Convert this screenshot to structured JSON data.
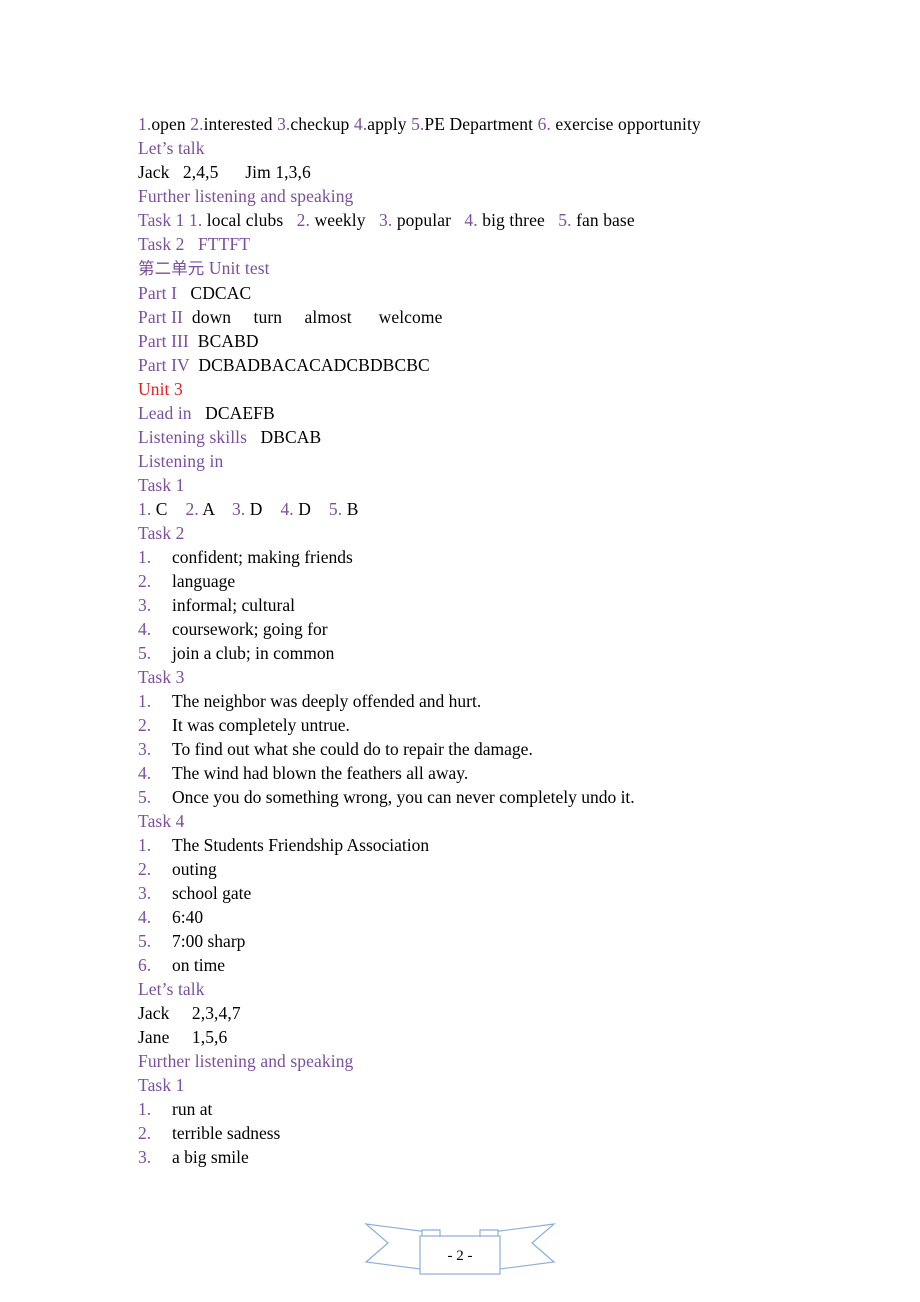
{
  "document": {
    "page_number_label": "- 2 -",
    "colors": {
      "heading_purple": "#7B4F9D",
      "heading_red": "#E02020",
      "body_black": "#000000",
      "ribbon_blue": "#8BAFD6"
    }
  },
  "lines": {
    "l01": {
      "n1": "1.",
      "a1": "open ",
      "n2": "2.",
      "a2": "interested ",
      "n3": "3.",
      "a3": "checkup ",
      "n4": "4.",
      "a4": "apply ",
      "n5": "5.",
      "a5": "PE Department ",
      "n6": "6.",
      "a6": " exercise opportunity"
    },
    "l02": "Let’s talk",
    "l03": "Jack   2,4,5      Jim 1,3,6",
    "l04": "Further listening and speaking",
    "l05": {
      "task": "Task 1 ",
      "n1": "1.",
      "a1": " local clubs   ",
      "n2": "2.",
      "a2": " weekly   ",
      "n3": "3.",
      "a3": " popular   ",
      "n4": "4.",
      "a4": " big three   ",
      "n5": "5.",
      "a5": " fan base"
    },
    "l06": "Task 2   FTTFT",
    "l07_cjk": "第二单元",
    "l07_en": " Unit test",
    "l08_label": "Part I",
    "l08_value": "   CDCAC",
    "l09_label": "Part II",
    "l09_value": "  down     turn     almost      welcome",
    "l10_label": "Part III",
    "l10_value": "  BCABD",
    "l11_label": "Part IV",
    "l11_value": "  DCBADBACACADCBDBCBC",
    "l12": "Unit 3",
    "l13_label": "Lead in",
    "l13_value": "   DCAEFB",
    "l14_label": "Listening skills",
    "l14_value": "   DBCAB",
    "l15": "Listening in",
    "l16": "Task 1",
    "l17": {
      "n1": "1.",
      "a1": " C    ",
      "n2": "2.",
      "a2": " A    ",
      "n3": "3.",
      "a3": " D    ",
      "n4": "4.",
      "a4": " D    ",
      "n5": "5.",
      "a5": " B"
    },
    "l18": "Task 2",
    "l25": "Task 3",
    "l31": "Task 4",
    "l38": "Let’s talk",
    "l39": "Jack     2,3,4,7",
    "l40": "Jane     1,5,6",
    "l41": "Further listening and speaking",
    "l42": "Task 1"
  },
  "task2_items": [
    {
      "marker": "1.",
      "text": "confident; making friends"
    },
    {
      "marker": "2.",
      "text": "language"
    },
    {
      "marker": "3.",
      "text": "informal; cultural"
    },
    {
      "marker": "4.",
      "text": "coursework; going for"
    },
    {
      "marker": "5.",
      "text": "join a club; in common"
    }
  ],
  "task3_items": [
    {
      "marker": "1.",
      "text": "The neighbor was deeply offended and hurt."
    },
    {
      "marker": "2.",
      "text": "It was completely untrue."
    },
    {
      "marker": "3.",
      "text": "To find out what she could do to repair the damage."
    },
    {
      "marker": "4.",
      "text": "The wind had blown the feathers all away."
    },
    {
      "marker": "5.",
      "text": "Once you do something wrong, you can never completely undo it."
    }
  ],
  "task4_items": [
    {
      "marker": "1.",
      "text": "The Students Friendship Association"
    },
    {
      "marker": "2.",
      "text": "outing"
    },
    {
      "marker": "3.",
      "text": "school gate"
    },
    {
      "marker": "4.",
      "text": "6:40"
    },
    {
      "marker": "5.",
      "text": "7:00 sharp"
    },
    {
      "marker": "6.",
      "text": "on time"
    }
  ],
  "further_task1_items": [
    {
      "marker": "1.",
      "text": "run at"
    },
    {
      "marker": "2.",
      "text": "terrible sadness"
    },
    {
      "marker": "3.",
      "text": "a big smile"
    }
  ]
}
